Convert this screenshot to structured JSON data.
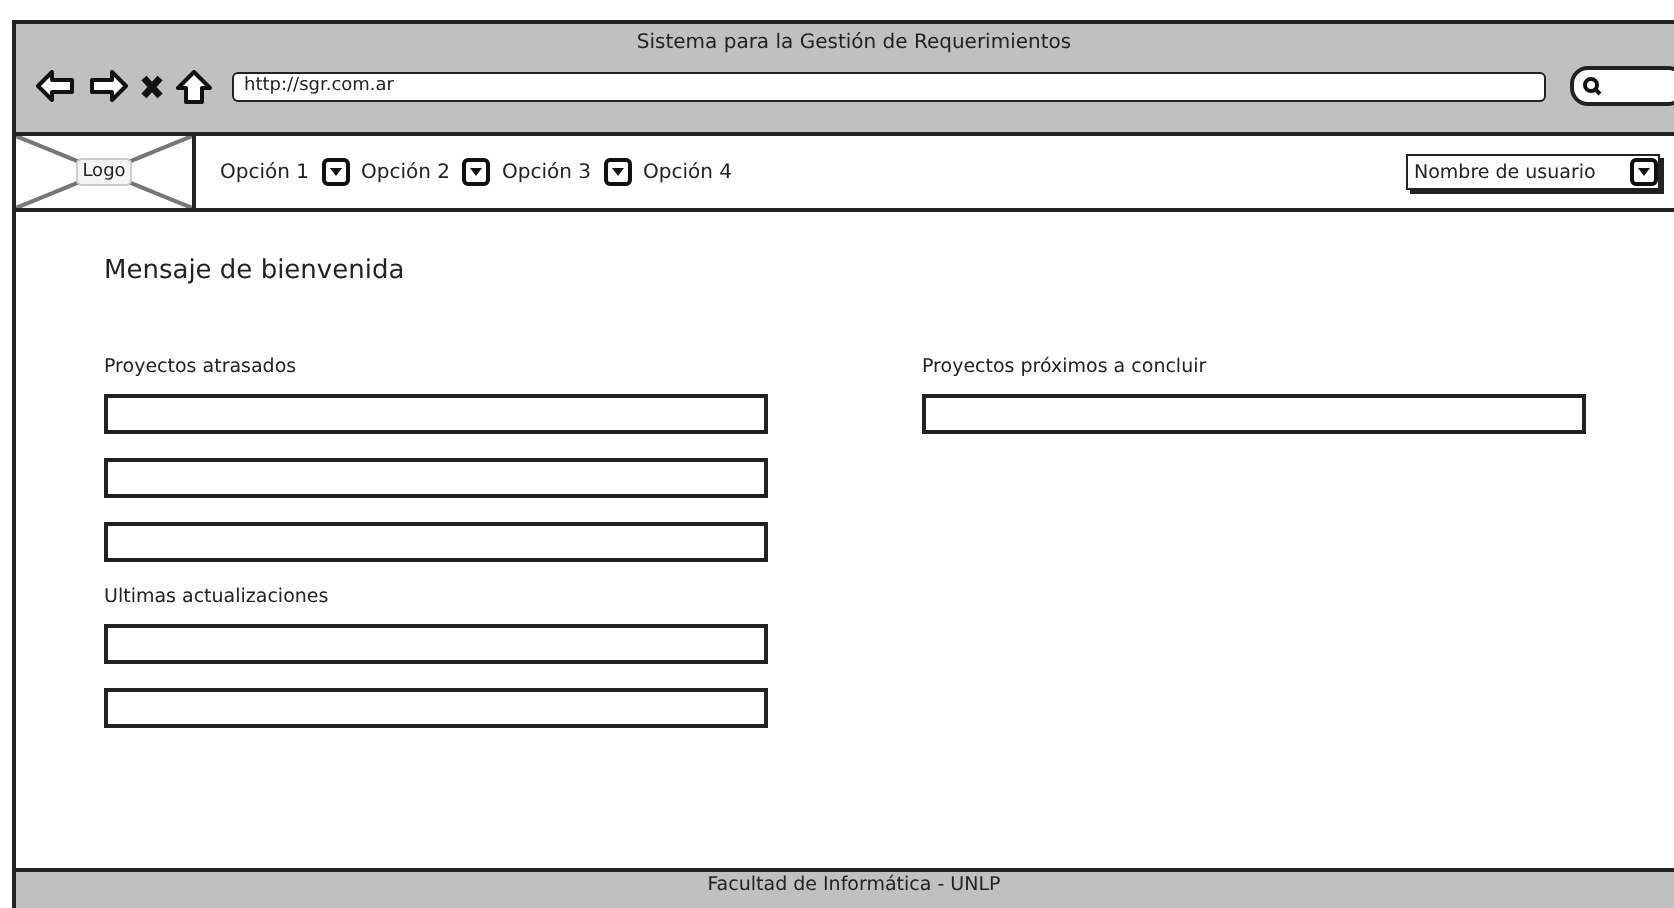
{
  "window": {
    "title": "Sistema para la Gestión de Requerimientos"
  },
  "browser": {
    "url": "http://sgr.com.ar"
  },
  "navbar": {
    "logo": "Logo",
    "options": [
      {
        "label": "Opción 1"
      },
      {
        "label": "Opción 2"
      },
      {
        "label": "Opción 3"
      },
      {
        "label": "Opción 4"
      }
    ],
    "user_menu": "Nombre de usuario"
  },
  "content": {
    "welcome": "Mensaje de bienvenida",
    "left_sections": [
      {
        "title": "Proyectos atrasados",
        "fields": [
          {
            "kind": "input"
          },
          {
            "kind": "input"
          },
          {
            "kind": "input"
          }
        ]
      },
      {
        "title": "Ultimas actualizaciones",
        "fields": [
          {
            "kind": "input"
          },
          {
            "kind": "input"
          }
        ]
      }
    ],
    "right_sections": [
      {
        "title": "Proyectos próximos a concluir",
        "fields": [
          {
            "kind": "input"
          }
        ]
      }
    ]
  },
  "footer": "Facultad de Informática - UNLP"
}
